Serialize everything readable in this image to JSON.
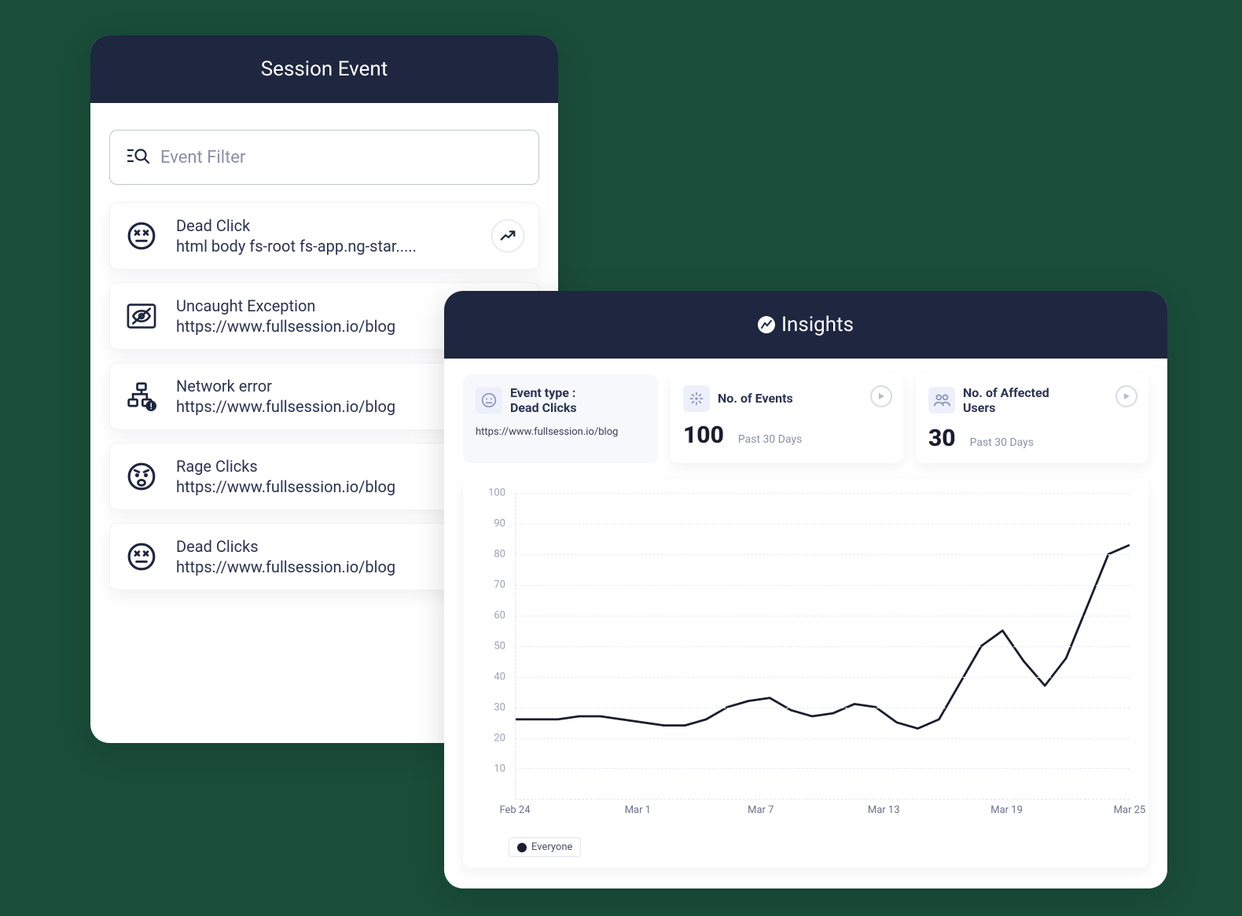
{
  "session_panel": {
    "title": "Session Event",
    "filter_placeholder": "Event Filter",
    "events": [
      {
        "icon": "dead-face",
        "title": "Dead Click",
        "sub": "html body fs-root fs-app.ng-star.....",
        "has_trend": true
      },
      {
        "icon": "eye-off",
        "title": "Uncaught Exception",
        "sub": "https://www.fullsession.io/blog",
        "has_trend": false
      },
      {
        "icon": "network",
        "title": "Network error",
        "sub": "https://www.fullsession.io/blog",
        "has_trend": false
      },
      {
        "icon": "rage-face",
        "title": "Rage Clicks",
        "sub": "https://www.fullsession.io/blog",
        "has_trend": false
      },
      {
        "icon": "dead-face",
        "title": "Dead Clicks",
        "sub": "https://www.fullsession.io/blog",
        "has_trend": false
      }
    ]
  },
  "insights_panel": {
    "title": "Insights",
    "stats": {
      "event_type": {
        "label": "Event type :",
        "value_label": "Dead Clicks",
        "url": "https://www.fullsession.io/blog"
      },
      "events_count": {
        "label": "No. of Events",
        "value": "100",
        "period": "Past 30 Days"
      },
      "affected_users": {
        "label": "No. of Affected Users",
        "value": "30",
        "period": "Past 30 Days"
      }
    },
    "legend": "Everyone"
  },
  "chart_data": {
    "type": "line",
    "ylabel": "",
    "xlabel": "",
    "ylim": [
      0,
      100
    ],
    "y_ticks": [
      100,
      90,
      80,
      70,
      60,
      50,
      40,
      30,
      20,
      10
    ],
    "x_ticks": [
      "Feb 24",
      "Mar 1",
      "Mar 7",
      "Mar 13",
      "Mar 19",
      "Mar 25"
    ],
    "series": [
      {
        "name": "Everyone",
        "x": [
          0,
          1,
          2,
          3,
          4,
          5,
          6,
          7,
          8,
          9,
          10,
          11,
          12,
          13,
          14,
          15,
          16,
          17,
          18,
          19,
          20,
          21,
          22,
          23,
          24,
          25,
          26,
          27,
          28,
          29
        ],
        "values": [
          26,
          26,
          26,
          27,
          27,
          26,
          25,
          24,
          24,
          26,
          30,
          32,
          33,
          29,
          27,
          28,
          31,
          30,
          25,
          23,
          26,
          38,
          50,
          55,
          45,
          37,
          46,
          63,
          80,
          83
        ]
      }
    ]
  }
}
